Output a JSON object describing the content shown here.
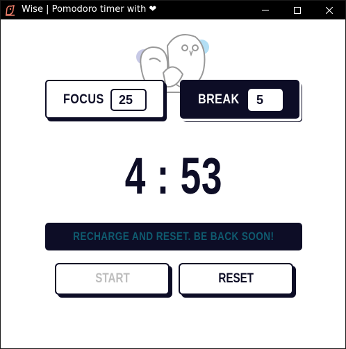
{
  "window": {
    "title": "Wise | Pomodoro timer with",
    "title_heart": "❤",
    "app_icon": "owl-icon",
    "controls": {
      "minimize": "minimize-icon",
      "maximize": "maximize-icon",
      "close": "close-icon"
    }
  },
  "modes": {
    "focus": {
      "label": "FOCUS",
      "value": "25"
    },
    "break": {
      "label": "BREAK",
      "value": "5"
    }
  },
  "timer": {
    "display": "4 : 53"
  },
  "message": {
    "text": "RECHARGE AND RESET. BE BACK SOON!"
  },
  "actions": {
    "start_label": "START",
    "reset_label": "RESET"
  },
  "colors": {
    "navy": "#0d0d26",
    "message_text": "#0f5b6f",
    "disabled_text": "#bdbdbd",
    "owl_blue": "#b3dff5",
    "owl_lavender": "#c7c9e6"
  }
}
